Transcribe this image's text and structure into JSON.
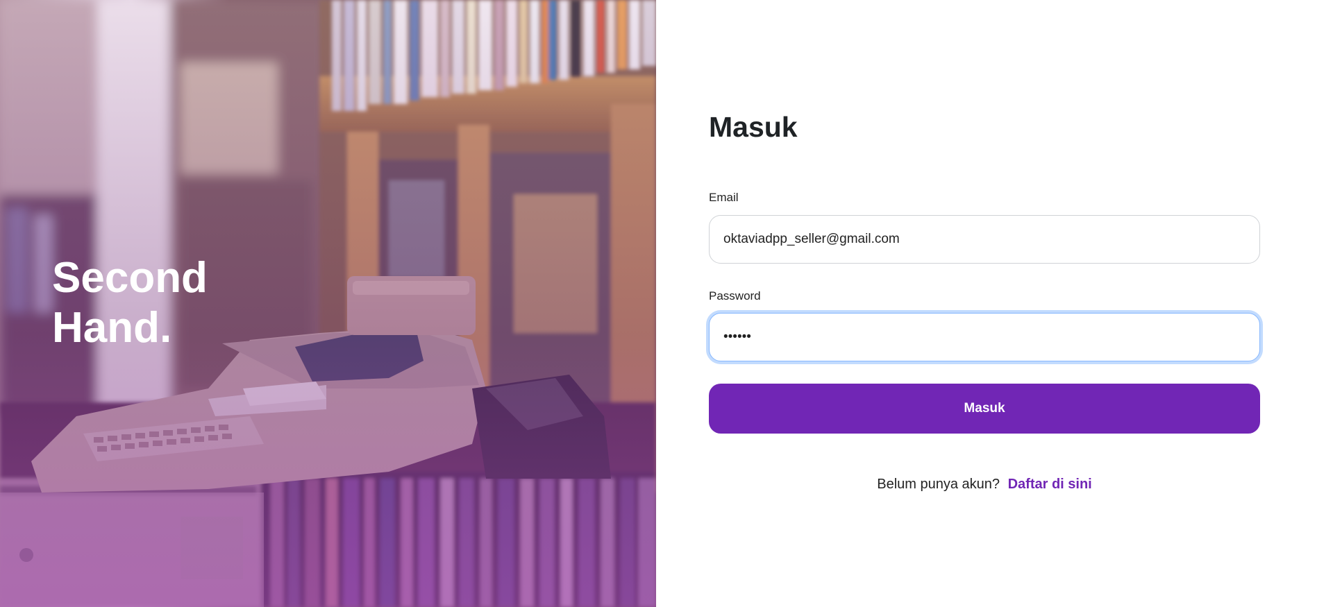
{
  "hero": {
    "brand_line1": "Second",
    "brand_line2": "Hand."
  },
  "login": {
    "heading": "Masuk",
    "email_label": "Email",
    "email_value": "oktaviadpp_seller@gmail.com",
    "password_label": "Password",
    "password_value": "123456",
    "submit_label": "Masuk",
    "signup_prompt": "Belum punya akun?",
    "signup_link": "Daftar di sini"
  },
  "colors": {
    "accent": "#7126b5",
    "focus_ring": "#86b7fe"
  }
}
